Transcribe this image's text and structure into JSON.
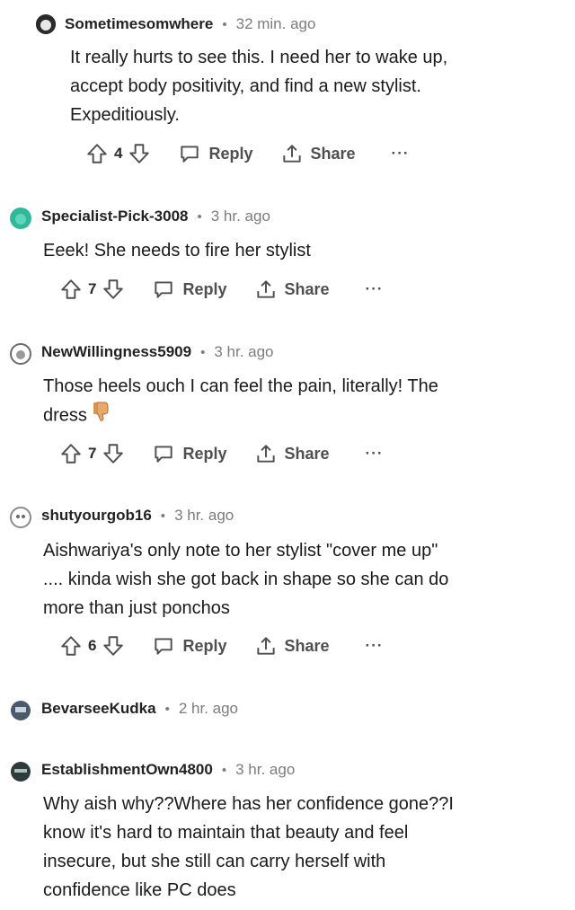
{
  "comments": [
    {
      "username": "Sometimesomwhere",
      "separator": "•",
      "time": "32 min. ago",
      "lines": [
        "It really hurts to see this. I need her to wake up,",
        "accept body positivity, and find a new stylist.",
        "Expeditiously."
      ],
      "votes": "4",
      "reply": "Reply",
      "share": "Share",
      "more": "···",
      "avatar_color": "#2b2b2b"
    },
    {
      "username": "Specialist-Pick-3008",
      "separator": "•",
      "time": "3 hr. ago",
      "lines": [
        "Eeek! She needs to fire her stylist"
      ],
      "votes": "7",
      "reply": "Reply",
      "share": "Share",
      "more": "···",
      "avatar_color": "#2fb89a"
    },
    {
      "username": "NewWillingness5909",
      "separator": "•",
      "time": "3 hr. ago",
      "lines": [
        "Those heels ouch I can feel the pain, literally! The",
        "dress"
      ],
      "votes": "7",
      "reply": "Reply",
      "share": "Share",
      "more": "···",
      "avatar_color": "#7a7a7a"
    },
    {
      "username": "shutyourgob16",
      "separator": "•",
      "time": "3 hr. ago",
      "lines": [
        "Aishwariya's only note to her stylist \"cover me up\"",
        ".... kinda wish she got back in shape so she can do",
        "more than just ponchos"
      ],
      "votes": "6",
      "reply": "Reply",
      "share": "Share",
      "more": "···",
      "avatar_color": "#9a9a9a"
    },
    {
      "username": "BevarseeKudka",
      "separator": "•",
      "time": "2 hr. ago",
      "avatar_color": "#4a5a6a"
    },
    {
      "username": "EstablishmentOwn4800",
      "separator": "•",
      "time": "3 hr. ago",
      "lines": [
        "Why aish why??Where has her confidence gone??I",
        "know it's hard to maintain that beauty and feel",
        "insecure, but she still can carry herself with",
        "confidence like PC does"
      ],
      "avatar_color": "#2f3a3a"
    }
  ],
  "icons": {
    "upvote": "upvote-icon",
    "downvote": "downvote-icon",
    "reply": "reply-bubble-icon",
    "share": "share-icon",
    "emoji": "thumbs-down-emoji"
  }
}
